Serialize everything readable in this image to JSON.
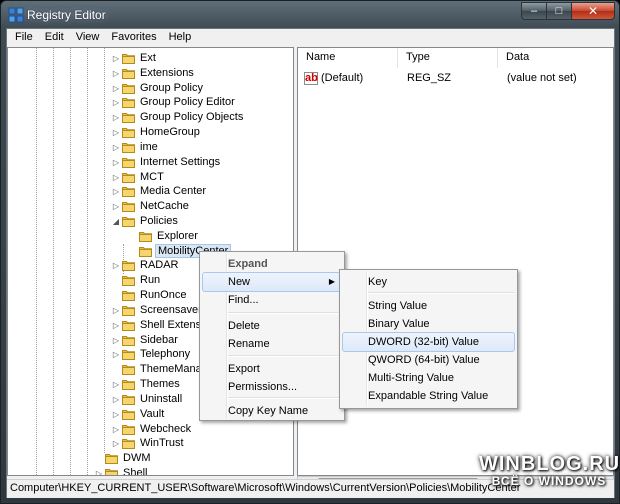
{
  "window": {
    "title": "Registry Editor",
    "caption_buttons": {
      "minimize": "–",
      "maximize": "□",
      "close": "✕"
    }
  },
  "menubar": [
    "File",
    "Edit",
    "View",
    "Favorites",
    "Help"
  ],
  "tree": [
    {
      "label": "Ext",
      "expander": "▷"
    },
    {
      "label": "Extensions",
      "expander": "▷"
    },
    {
      "label": "Group Policy",
      "expander": "▷"
    },
    {
      "label": "Group Policy Editor",
      "expander": "▷"
    },
    {
      "label": "Group Policy Objects",
      "expander": "▷"
    },
    {
      "label": "HomeGroup",
      "expander": "▷"
    },
    {
      "label": "ime",
      "expander": "▷"
    },
    {
      "label": "Internet Settings",
      "expander": "▷"
    },
    {
      "label": "MCT",
      "expander": "▷"
    },
    {
      "label": "Media Center",
      "expander": "▷"
    },
    {
      "label": "NetCache",
      "expander": "▷"
    },
    {
      "label": "Policies",
      "expander": "◢"
    },
    {
      "label": "Explorer",
      "expander": ""
    },
    {
      "label": "MobilityCenter",
      "expander": "",
      "selected": true
    },
    {
      "label": "RADAR",
      "expander": "▷"
    },
    {
      "label": "Run",
      "expander": ""
    },
    {
      "label": "RunOnce",
      "expander": ""
    },
    {
      "label": "Screensavers",
      "expander": "▷"
    },
    {
      "label": "Shell Extensio",
      "expander": "▷"
    },
    {
      "label": "Sidebar",
      "expander": "▷"
    },
    {
      "label": "Telephony",
      "expander": "▷"
    },
    {
      "label": "ThemeManag",
      "expander": ""
    },
    {
      "label": "Themes",
      "expander": "▷"
    },
    {
      "label": "Uninstall",
      "expander": "▷"
    },
    {
      "label": "Vault",
      "expander": "▷"
    },
    {
      "label": "Webcheck",
      "expander": "▷"
    },
    {
      "label": "WinTrust",
      "expander": "▷"
    },
    {
      "label": "DWM",
      "expander": ""
    },
    {
      "label": "Shell",
      "expander": "▷"
    }
  ],
  "values": {
    "columns": [
      "Name",
      "Type",
      "Data"
    ],
    "rows": [
      {
        "icon": "ab",
        "name": "(Default)",
        "type": "REG_SZ",
        "data": "(value not set)"
      }
    ]
  },
  "context_menu": [
    {
      "label": "Expand",
      "bold": true
    },
    {
      "label": "New",
      "submenu": true,
      "highlighted": true
    },
    {
      "label": "Find..."
    },
    {
      "label": "Delete"
    },
    {
      "label": "Rename"
    },
    {
      "label": "Export"
    },
    {
      "label": "Permissions..."
    },
    {
      "label": "Copy Key Name"
    }
  ],
  "submenu_arrow": "▶",
  "new_submenu": [
    {
      "label": "Key"
    },
    {
      "label": "String Value"
    },
    {
      "label": "Binary Value"
    },
    {
      "label": "DWORD (32-bit) Value",
      "highlighted": true
    },
    {
      "label": "QWORD (64-bit) Value"
    },
    {
      "label": "Multi-String Value"
    },
    {
      "label": "Expandable String Value"
    }
  ],
  "statusbar": "Computer\\HKEY_CURRENT_USER\\Software\\Microsoft\\Windows\\CurrentVersion\\Policies\\MobilityCenter",
  "watermark": {
    "line1": "WINBLOG.RU",
    "line2": "ВСЁ О WINDOWS"
  },
  "colors": {
    "folder": "#e8c04a",
    "selection": "#d9e7f5",
    "menu_highlight": "#dde9f8"
  }
}
